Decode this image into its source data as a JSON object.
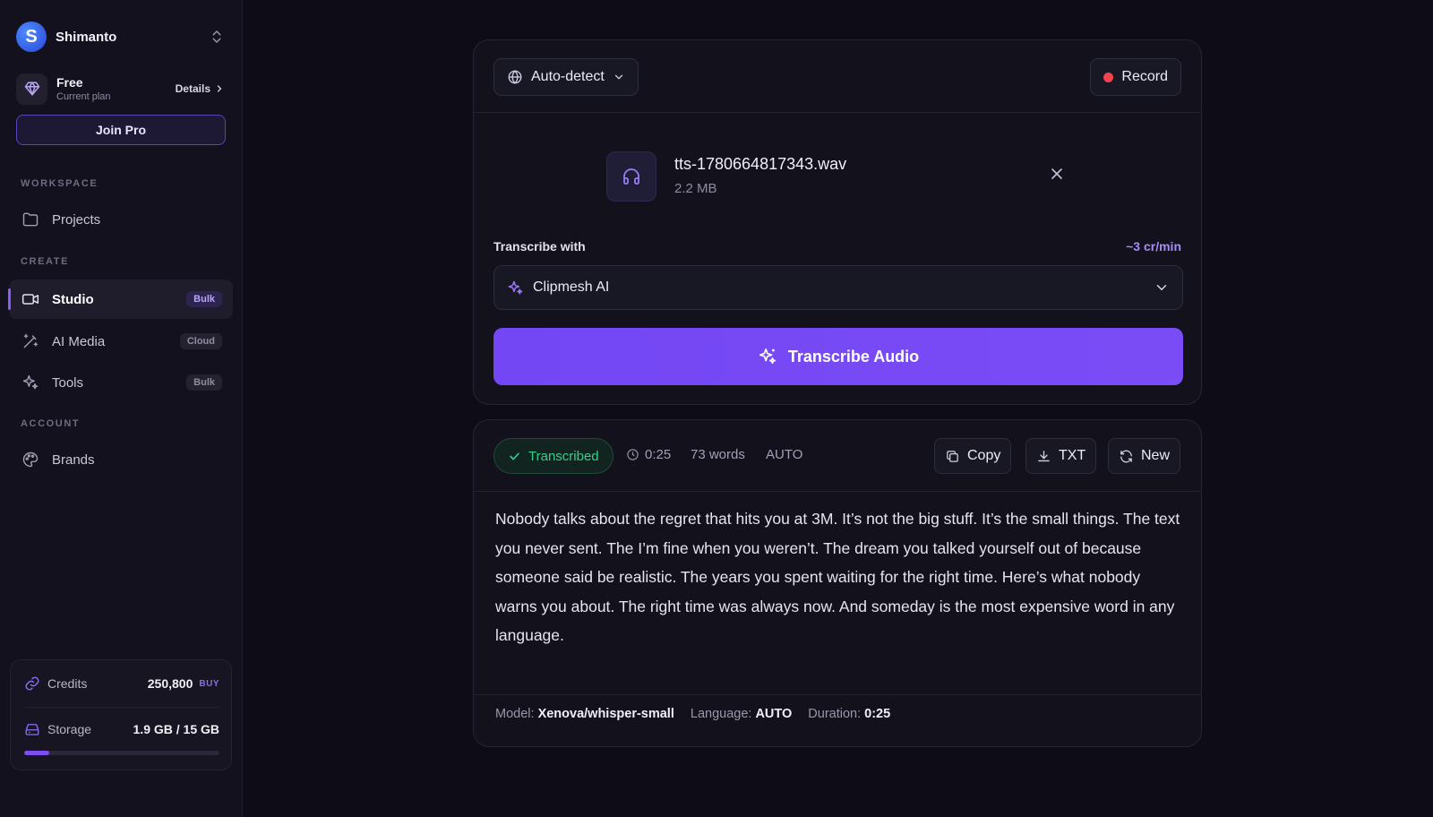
{
  "account": {
    "name": "Shimanto",
    "logo_letter": "S"
  },
  "plan": {
    "name": "Free",
    "subtitle": "Current plan",
    "details_label": "Details"
  },
  "join_pro_label": "Join Pro",
  "sidebar": {
    "sections": {
      "workspace": "WORKSPACE",
      "create": "CREATE",
      "account": "ACCOUNT"
    },
    "items": [
      {
        "label": "Projects",
        "icon": "folder-icon"
      },
      {
        "label": "Studio",
        "badge": "Bulk",
        "icon": "video-icon",
        "active": true
      },
      {
        "label": "AI Media",
        "badge": "Cloud",
        "icon": "magic-wand-icon"
      },
      {
        "label": "Tools",
        "badge": "Bulk",
        "icon": "sparkles-icon"
      },
      {
        "label": "Brands",
        "icon": "palette-icon"
      }
    ]
  },
  "usage": {
    "credits_label": "Credits",
    "credits_value": "250,800",
    "buy_label": "BUY",
    "storage_label": "Storage",
    "storage_value": "1.9 GB / 15 GB",
    "storage_fraction": 0.127
  },
  "upload": {
    "language_label": "Auto-detect",
    "record_label": "Record",
    "file_name": "tts-1780664817343.wav",
    "file_size": "2.2 MB",
    "transcribe_with_label": "Transcribe with",
    "cost_label": "~3 cr/min",
    "model_option": "Clipmesh AI",
    "transcribe_button": "Transcribe Audio"
  },
  "result": {
    "status": "Transcribed",
    "duration": "0:25",
    "words": "73 words",
    "language": "AUTO",
    "copy_label": "Copy",
    "txt_label": "TXT",
    "new_label": "New",
    "transcript": "Nobody talks about the regret that hits you at 3M. It’s not the big stuff. It’s the small things. The text you never sent. The I’m fine when you weren’t. The dream you talked yourself out of because someone said be realistic. The years you spent waiting for the right time. Here’s what nobody warns you about. The right time was always now. And someday is the most expensive word in any language.",
    "footer": {
      "model_key": "Model:",
      "model_value": "Xenova/whisper-small",
      "language_key": "Language:",
      "language_value": "AUTO",
      "duration_key": "Duration:",
      "duration_value": "0:25"
    }
  },
  "colors": {
    "accent": "#7347f4",
    "success": "#34d08a",
    "record": "#f04452",
    "background": "#0d0c17",
    "sidebar": "#12111d"
  }
}
